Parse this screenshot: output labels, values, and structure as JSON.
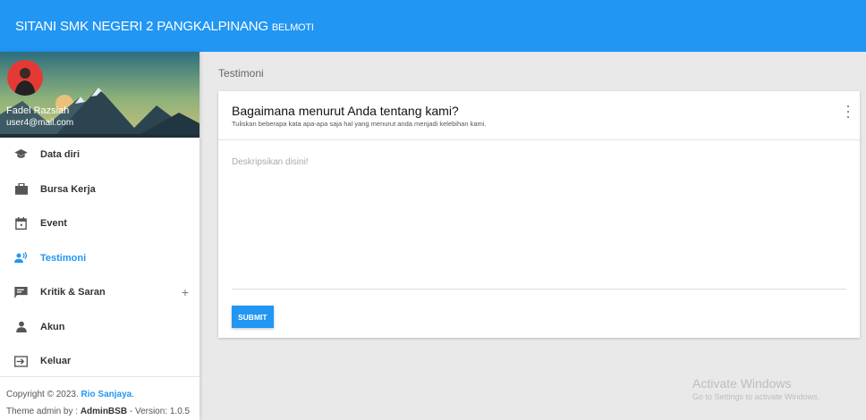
{
  "header": {
    "brand": "SITANI SMK NEGERI 2 PANGKALPINANG",
    "brand_sub": "BELMOTI"
  },
  "user": {
    "name": "Fadel Razsiah",
    "email": "user4@mail.com"
  },
  "sidebar": {
    "items": [
      {
        "label": "Data diri",
        "icon": "school-icon"
      },
      {
        "label": "Bursa Kerja",
        "icon": "briefcase-icon"
      },
      {
        "label": "Event",
        "icon": "calendar-icon"
      },
      {
        "label": "Testimoni",
        "icon": "record-voice-icon",
        "active": true
      },
      {
        "label": "Kritik & Saran",
        "icon": "feedback-icon",
        "expand": "+"
      },
      {
        "label": "Akun",
        "icon": "person-icon"
      },
      {
        "label": "Keluar",
        "icon": "logout-icon"
      }
    ]
  },
  "footer": {
    "copyright_prefix": "Copyright © 2023.",
    "author": "Rio Sanjaya",
    "period": ".",
    "theme_prefix": "Theme admin by :",
    "theme_name": "AdminBSB",
    "version": "- Version: 1.0.5"
  },
  "main": {
    "page_title": "Testimoni",
    "card": {
      "title": "Bagaimana menurut Anda tentang kami?",
      "subtitle": "Tuliskan beberapa kata apa-apa saja hal yang menurut anda menjadi kelebihan kami.",
      "textarea_placeholder": "Deskripsikan disini!",
      "textarea_value": "",
      "submit_label": "SUBMIT"
    }
  },
  "watermark": {
    "line1": "Activate Windows",
    "line2": "Go to Settings to activate Windows."
  },
  "colors": {
    "primary": "#2196f3",
    "background": "#e9e9e9"
  }
}
